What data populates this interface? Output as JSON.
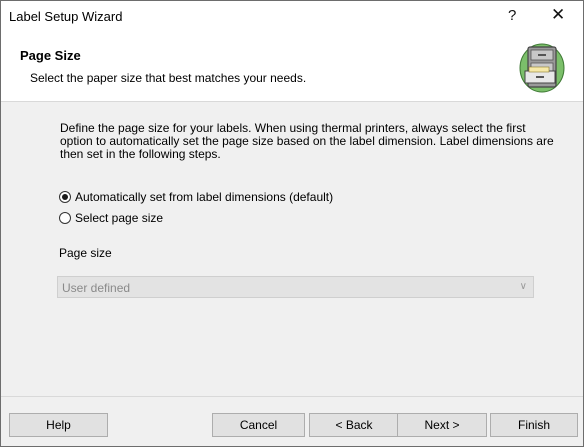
{
  "window": {
    "title": "Label Setup Wizard",
    "help_glyph": "?",
    "close_glyph": "✕"
  },
  "header": {
    "title": "Page Size",
    "subtitle": "Select the paper size that best matches your needs.",
    "icon": "file-cabinet-icon"
  },
  "content": {
    "description": "Define the page size for your labels. When using thermal printers, always select the first option to automatically set the page size based on the label dimension. Label dimensions are then set in the following steps.",
    "options": [
      {
        "label": "Automatically set from label dimensions (default)",
        "selected": true
      },
      {
        "label": "Select page size",
        "selected": false
      }
    ],
    "page_size_label": "Page size",
    "page_size_value": "User defined",
    "page_size_disabled": true
  },
  "buttons": {
    "help": "Help",
    "cancel": "Cancel",
    "back": "< Back",
    "next": "Next >",
    "finish": "Finish"
  }
}
